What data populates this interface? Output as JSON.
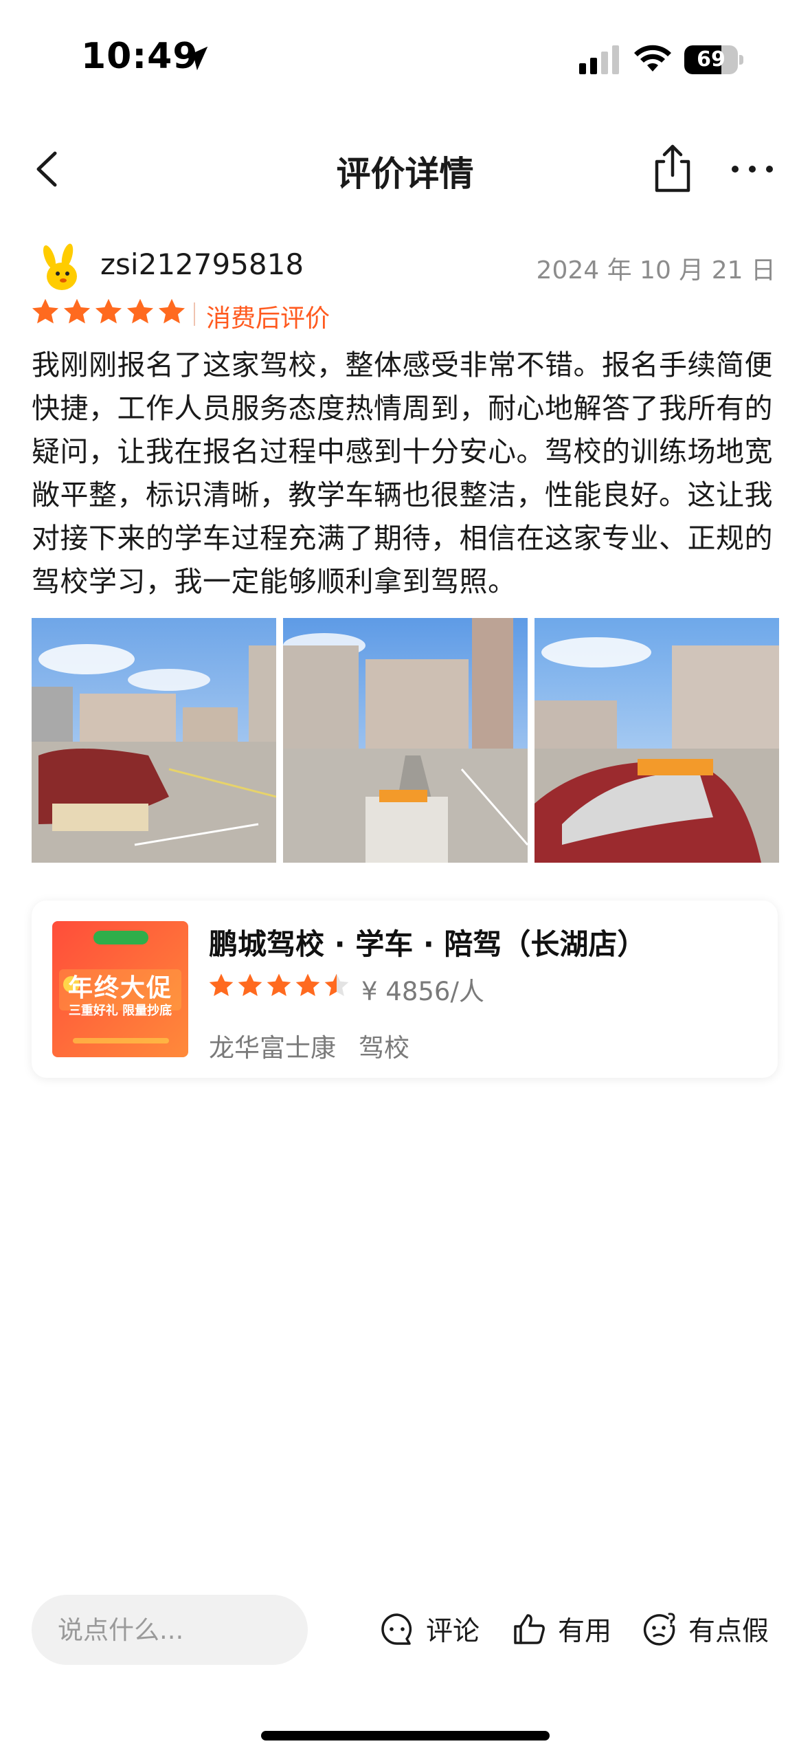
{
  "status_bar": {
    "time": "10:49",
    "battery": "69",
    "battery_level": 0.69
  },
  "nav": {
    "title": "评价详情"
  },
  "review": {
    "username": "zsi212795818",
    "date": "2024 年 10 月 21 日",
    "rating": 5,
    "tag": "消费后评价",
    "text": "我刚刚报名了这家驾校，整体感受非常不错。报名手续简便快捷，工作人员服务态度热情周到，耐心地解答了我所有的疑问，让我在报名过程中感到十分安心。驾校的训练场地宽敞平整，标识清晰，教学车辆也很整洁，性能良好。这让我对接下来的学车过程充满了期待，相信在这家专业、正规的驾校学习，我一定能够顺利拿到驾照。",
    "photo_count": 3
  },
  "shop": {
    "name": "鹏城驾校 · 学车 · 陪驾（长湖店）",
    "rating": 4.5,
    "price": "¥ 4856/人",
    "area": "龙华富士康",
    "category": "驾校",
    "thumb_text_main": "年终大促",
    "thumb_text_sub": "三重好礼 限量抄底"
  },
  "bottom_bar": {
    "input_placeholder": "说点什么...",
    "comment_label": "评论",
    "useful_label": "有用",
    "fake_label": "有点假"
  },
  "colors": {
    "star": "#ff6a1f",
    "tag": "#ff5a1f",
    "muted": "#8c8c8c"
  }
}
